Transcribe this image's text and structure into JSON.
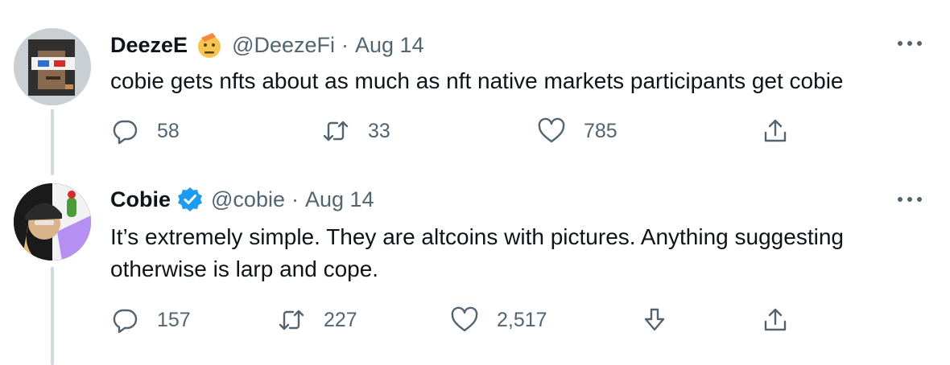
{
  "tweets": [
    {
      "name": "DeezeE",
      "handle": "@DeezeFi",
      "separator": "·",
      "date": "Aug 14",
      "emoji": "saluting-face-emoji",
      "text": "cobie gets nfts about as much as nft native markets participants get cobie",
      "replies": "58",
      "retweets": "33",
      "likes": "785"
    },
    {
      "name": "Cobie",
      "handle": "@cobie",
      "separator": "·",
      "date": "Aug 14",
      "verified": true,
      "text": "It’s extremely simple. They are altcoins with pictures. Anything suggesting otherwise is larp and cope.",
      "replies": "157",
      "retweets": "227",
      "likes": "2,517"
    }
  ],
  "colors": {
    "text": "#0f1419",
    "secondary": "#536471",
    "thread_line": "#cfd9de",
    "verified": "#1d9bf0"
  }
}
